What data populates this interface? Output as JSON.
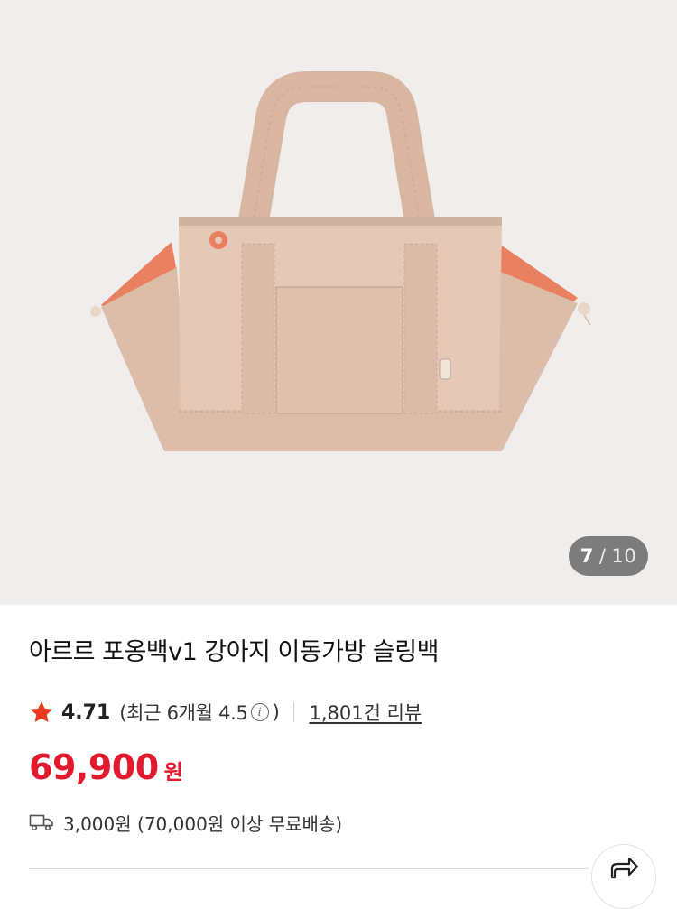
{
  "gallery": {
    "image_alt": "아르르 포옹백v1 강아지 이동가방 슬링백",
    "current_page": "7",
    "separator": "/",
    "total_pages": "10"
  },
  "product": {
    "title": "아르르 포옹백v1 강아지 이동가방 슬링백",
    "rating": "4.71",
    "recent_prefix": "(최근 6개월 4.5",
    "recent_suffix": ")",
    "review_link": "1,801건 리뷰",
    "price": "69,900",
    "currency": "원",
    "shipping": "3,000원 (70,000원 이상 무료배송)"
  },
  "icons": {
    "star": "star-icon",
    "info": "info-icon",
    "truck": "truck-icon",
    "share": "share-icon"
  },
  "colors": {
    "price": "#e3192d",
    "star": "#e83a1c",
    "gallery_bg": "#efeeed",
    "bag_body": "#e5c8b6",
    "bag_accent": "#e9805f"
  }
}
